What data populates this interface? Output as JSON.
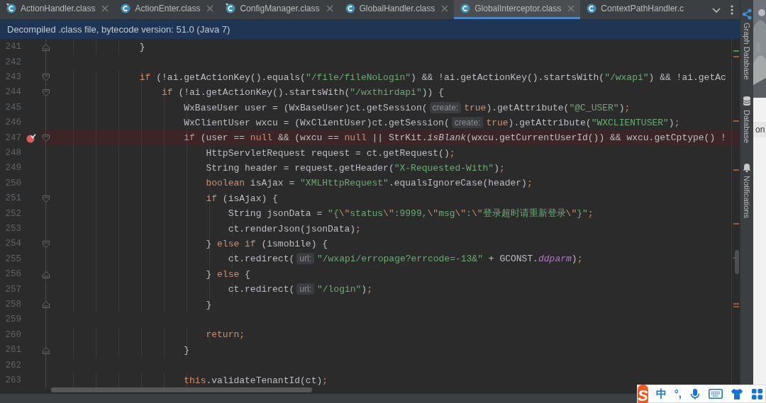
{
  "tabs": [
    {
      "label": "ActionHandler.class",
      "selected": false,
      "pinned": true,
      "closable": true
    },
    {
      "label": "ActionEnter.class",
      "selected": false,
      "pinned": false,
      "closable": true
    },
    {
      "label": "ConfigManager.class",
      "selected": false,
      "pinned": true,
      "closable": true
    },
    {
      "label": "GlobalHandler.class",
      "selected": false,
      "pinned": false,
      "closable": true
    },
    {
      "label": "GlobalInterceptor.class",
      "selected": true,
      "pinned": false,
      "closable": true
    },
    {
      "label": "ContextPathHandler.c",
      "selected": false,
      "pinned": false,
      "closable": false
    }
  ],
  "banner": {
    "text": "Decompiled .class file, bytecode version: 51.0 (Java 7)"
  },
  "editor": {
    "lines": [
      {
        "number": "241",
        "breakpoint": false,
        "kind": "block-end",
        "segments": [
          {
            "kind": "plain",
            "text": "                }"
          }
        ]
      },
      {
        "number": "242",
        "breakpoint": false,
        "kind": "line"
      },
      {
        "number": "243",
        "breakpoint": false,
        "kind": "block-start",
        "segments": [
          {
            "kind": "keyword",
            "text": "                if"
          },
          {
            "kind": "plain",
            "text": " (!ai.getActionKey().equals("
          },
          {
            "kind": "string",
            "text": "\"/file/fileNoLogin\""
          },
          {
            "kind": "plain",
            "text": ") && !ai.getActionKey().startsWith("
          },
          {
            "kind": "string",
            "text": "\"/wxapi\""
          },
          {
            "kind": "plain",
            "text": ") && !ai.getAc"
          }
        ]
      },
      {
        "number": "244",
        "breakpoint": false,
        "kind": "block-start",
        "segments": [
          {
            "kind": "keyword",
            "text": "                    if"
          },
          {
            "kind": "plain",
            "text": " (!ai.getActionKey().startsWith("
          },
          {
            "kind": "string",
            "text": "\"/wxthirdapi\""
          },
          {
            "kind": "plain",
            "text": ")) {"
          }
        ]
      },
      {
        "number": "245",
        "breakpoint": false,
        "kind": "line",
        "segments": [
          {
            "kind": "plain",
            "text": "                        WxBaseUser user = (WxBaseUser)ct.getSession("
          },
          {
            "kind": "hint",
            "text": "create:"
          },
          {
            "kind": "keyword",
            "text": "true"
          },
          {
            "kind": "plain",
            "text": ").getAttribute("
          },
          {
            "kind": "string",
            "text": "\"@C_USER\""
          },
          {
            "kind": "plain",
            "text": ")"
          },
          {
            "kind": "keyword",
            "text": ";"
          }
        ]
      },
      {
        "number": "246",
        "breakpoint": false,
        "kind": "line",
        "segments": [
          {
            "kind": "plain",
            "text": "                        WxClientUser wxcu = (WxClientUser)ct.getSession("
          },
          {
            "kind": "hint",
            "text": "create:"
          },
          {
            "kind": "keyword",
            "text": "true"
          },
          {
            "kind": "plain",
            "text": ").getAttribute("
          },
          {
            "kind": "string",
            "text": "\"WXCLIENTUSER\""
          },
          {
            "kind": "plain",
            "text": ")"
          },
          {
            "kind": "keyword",
            "text": ";"
          }
        ]
      },
      {
        "number": "247",
        "breakpoint": true,
        "kind": "block-start",
        "segments": [
          {
            "kind": "keyword",
            "text": "                        if"
          },
          {
            "kind": "plain",
            "text": " (user == "
          },
          {
            "kind": "keyword",
            "text": "null"
          },
          {
            "kind": "plain",
            "text": " && (wxcu == "
          },
          {
            "kind": "keyword",
            "text": "null"
          },
          {
            "kind": "plain",
            "text": " || StrKit."
          },
          {
            "kind": "static",
            "text": "isBlank"
          },
          {
            "kind": "plain",
            "text": "(wxcu.getCurrentUserId()) && wxcu.getCptype() !"
          }
        ]
      },
      {
        "number": "248",
        "breakpoint": false,
        "kind": "line",
        "segments": [
          {
            "kind": "plain",
            "text": "                            HttpServletRequest request = ct.getRequest()"
          },
          {
            "kind": "keyword",
            "text": ";"
          }
        ]
      },
      {
        "number": "249",
        "breakpoint": false,
        "kind": "line",
        "segments": [
          {
            "kind": "plain",
            "text": "                            String header = request.getHeader("
          },
          {
            "kind": "string",
            "text": "\"X-Requested-With\""
          },
          {
            "kind": "plain",
            "text": ")"
          },
          {
            "kind": "keyword",
            "text": ";"
          }
        ]
      },
      {
        "number": "250",
        "breakpoint": false,
        "kind": "line",
        "segments": [
          {
            "kind": "keyword",
            "text": "                            boolean"
          },
          {
            "kind": "plain",
            "text": " isAjax = "
          },
          {
            "kind": "string",
            "text": "\"XMLHttpRequest\""
          },
          {
            "kind": "plain",
            "text": ".equalsIgnoreCase(header)"
          },
          {
            "kind": "keyword",
            "text": ";"
          }
        ]
      },
      {
        "number": "251",
        "breakpoint": false,
        "kind": "block-start",
        "segments": [
          {
            "kind": "keyword",
            "text": "                            if"
          },
          {
            "kind": "plain",
            "text": " (isAjax) {"
          }
        ]
      },
      {
        "number": "252",
        "breakpoint": false,
        "kind": "line",
        "segments": [
          {
            "kind": "plain",
            "text": "                                String jsonData = "
          },
          {
            "kind": "string",
            "text": "\"{"
          },
          {
            "kind": "escape",
            "text": "\\\""
          },
          {
            "kind": "string",
            "text": "status"
          },
          {
            "kind": "escape",
            "text": "\\\""
          },
          {
            "kind": "string",
            "text": ":9999,"
          },
          {
            "kind": "escape",
            "text": "\\\""
          },
          {
            "kind": "string",
            "text": "msg"
          },
          {
            "kind": "escape",
            "text": "\\\""
          },
          {
            "kind": "string",
            "text": ":"
          },
          {
            "kind": "escape",
            "text": "\\\""
          },
          {
            "kind": "string",
            "text": "登录超时请重新登录"
          },
          {
            "kind": "escape",
            "text": "\\\""
          },
          {
            "kind": "string",
            "text": "}\""
          },
          {
            "kind": "keyword",
            "text": ";"
          }
        ]
      },
      {
        "number": "253",
        "breakpoint": false,
        "kind": "line",
        "segments": [
          {
            "kind": "plain",
            "text": "                                ct.renderJson(jsonData)"
          },
          {
            "kind": "keyword",
            "text": ";"
          }
        ]
      },
      {
        "number": "254",
        "breakpoint": false,
        "kind": "block-start",
        "segments": [
          {
            "kind": "plain",
            "text": "                            } "
          },
          {
            "kind": "keyword",
            "text": "else if"
          },
          {
            "kind": "plain",
            "text": " (ismobile) {"
          }
        ]
      },
      {
        "number": "255",
        "breakpoint": false,
        "kind": "line",
        "segments": [
          {
            "kind": "plain",
            "text": "                                ct.redirect("
          },
          {
            "kind": "hint",
            "text": "url:"
          },
          {
            "kind": "string",
            "text": "\"/wxapi/erropage?errcode=-13&\""
          },
          {
            "kind": "plain",
            "text": " + GCONST."
          },
          {
            "kind": "field",
            "text": "ddparm"
          },
          {
            "kind": "plain",
            "text": ")"
          },
          {
            "kind": "keyword",
            "text": ";"
          }
        ]
      },
      {
        "number": "256",
        "breakpoint": false,
        "kind": "block-end",
        "segments": [
          {
            "kind": "plain",
            "text": "                            } "
          },
          {
            "kind": "keyword",
            "text": "else"
          },
          {
            "kind": "plain",
            "text": " {"
          }
        ]
      },
      {
        "number": "257",
        "breakpoint": false,
        "kind": "line",
        "segments": [
          {
            "kind": "plain",
            "text": "                                ct.redirect("
          },
          {
            "kind": "hint",
            "text": "url:"
          },
          {
            "kind": "string",
            "text": "\"/login\""
          },
          {
            "kind": "plain",
            "text": ")"
          },
          {
            "kind": "keyword",
            "text": ";"
          }
        ]
      },
      {
        "number": "258",
        "breakpoint": false,
        "kind": "block-end",
        "segments": [
          {
            "kind": "plain",
            "text": "                            }"
          }
        ]
      },
      {
        "number": "259",
        "breakpoint": false,
        "kind": "line"
      },
      {
        "number": "260",
        "breakpoint": false,
        "kind": "line",
        "segments": [
          {
            "kind": "keyword",
            "text": "                            return;"
          }
        ]
      },
      {
        "number": "261",
        "breakpoint": false,
        "kind": "block-end",
        "segments": [
          {
            "kind": "plain",
            "text": "                        }"
          }
        ]
      },
      {
        "number": "262",
        "breakpoint": false,
        "kind": "line"
      },
      {
        "number": "263",
        "breakpoint": false,
        "kind": "line",
        "segments": [
          {
            "kind": "keyword",
            "text": "                        this"
          },
          {
            "kind": "plain",
            "text": ".validateTenantId(ct)"
          },
          {
            "kind": "keyword",
            "text": ";"
          }
        ]
      }
    ]
  },
  "tool_strip": {
    "items": [
      {
        "kind": "graph",
        "label": "Graph Database"
      },
      {
        "kind": "database",
        "label": "Database"
      },
      {
        "kind": "bell",
        "label": "Notifications"
      }
    ]
  },
  "background_window": {
    "text": "on"
  },
  "ime_toolbar": {
    "items": [
      {
        "kind": "logo",
        "text": "S"
      },
      {
        "kind": "text",
        "text": "中"
      },
      {
        "kind": "text",
        "text": "°,"
      },
      {
        "kind": "mic"
      },
      {
        "kind": "keyboard"
      },
      {
        "kind": "shirt"
      },
      {
        "kind": "grid"
      }
    ]
  }
}
